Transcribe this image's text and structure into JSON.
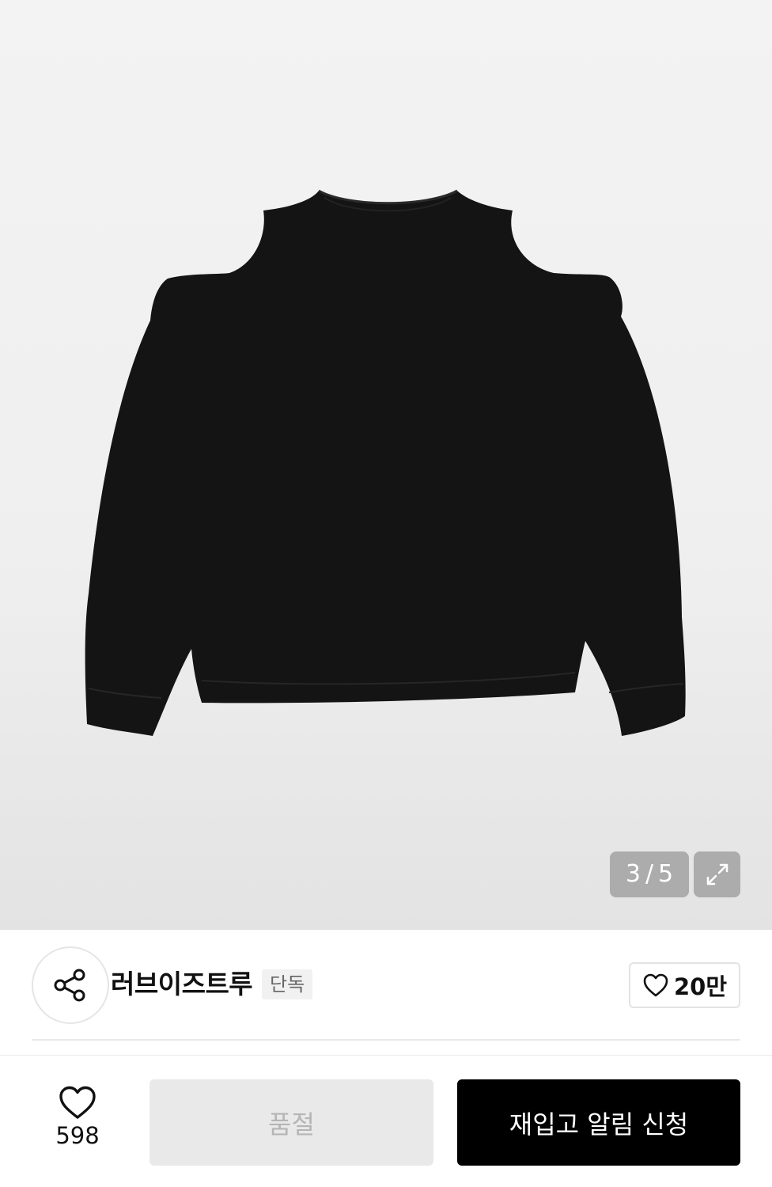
{
  "gallery": {
    "current": "3",
    "separator": "/",
    "total": "5",
    "expand_icon": "expand-arrows-icon"
  },
  "brand": {
    "name": "러브이즈트루",
    "badge": "단독",
    "share_icon": "share-icon",
    "like_count": "20만",
    "like_icon": "heart-outline-icon"
  },
  "actions": {
    "wish_count": "598",
    "wish_icon": "heart-outline-icon",
    "soldout_label": "품절",
    "restock_label": "재입고 알림 신청"
  },
  "colors": {
    "primary_button": "#000000",
    "disabled_button": "#e9e9e9",
    "disabled_text": "#b5b5b5"
  }
}
